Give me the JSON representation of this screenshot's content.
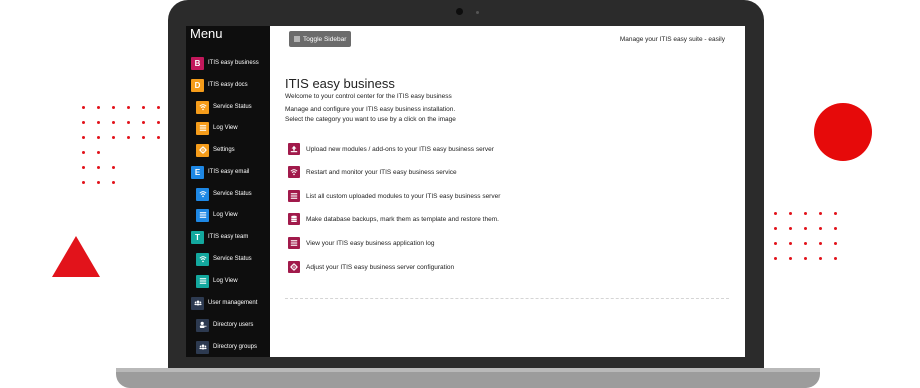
{
  "sidebar": {
    "title": "Menu",
    "items": [
      {
        "label": "ITIS easy business",
        "badge": "B",
        "color": "#c2185b",
        "level": 0
      },
      {
        "label": "ITIS easy docs",
        "badge": "D",
        "color": "#f59c1a",
        "level": 0
      },
      {
        "label": "Service Status",
        "icon": "wifi-icon",
        "color": "#f59c1a",
        "level": 1
      },
      {
        "label": "Log View",
        "icon": "list-icon",
        "color": "#f59c1a",
        "level": 1
      },
      {
        "label": "Settings",
        "icon": "gear-icon",
        "color": "#f59c1a",
        "level": 1
      },
      {
        "label": "ITIS easy email",
        "badge": "E",
        "color": "#1e88e5",
        "level": 0
      },
      {
        "label": "Service Status",
        "icon": "wifi-icon",
        "color": "#1e88e5",
        "level": 1
      },
      {
        "label": "Log View",
        "icon": "list-icon",
        "color": "#1e88e5",
        "level": 1
      },
      {
        "label": "ITIS easy team",
        "badge": "T",
        "color": "#13a89e",
        "level": 0
      },
      {
        "label": "Service Status",
        "icon": "wifi-icon",
        "color": "#13a89e",
        "level": 1
      },
      {
        "label": "Log View",
        "icon": "list-icon",
        "color": "#13a89e",
        "level": 1
      },
      {
        "label": "User management",
        "icon": "users-icon",
        "color": "#2d3a50",
        "level": 0
      },
      {
        "label": "Directory users",
        "icon": "user-icon",
        "color": "#2d3a50",
        "level": 1
      },
      {
        "label": "Directory groups",
        "icon": "users-icon",
        "color": "#2d3a50",
        "level": 1
      }
    ]
  },
  "header": {
    "toggle_label": "Toggle Sidebar",
    "tagline": "Manage your ITIS easy suite - easily"
  },
  "main": {
    "title": "ITIS easy business",
    "intro": [
      "Welcome to your control center for the ITIS easy business",
      "Manage and configure your ITIS easy business installation.",
      "Select the category you want to use by a click on the image"
    ],
    "actions": [
      {
        "label": "Upload new modules / add-ons to your ITIS easy business server",
        "icon": "upload-icon"
      },
      {
        "label": "Restart and monitor your ITIS easy business service",
        "icon": "wifi-icon"
      },
      {
        "label": "List all custom uploaded modules to your ITIS easy business server",
        "icon": "list-icon"
      },
      {
        "label": "Make database backups, mark them as template and restore them.",
        "icon": "database-icon"
      },
      {
        "label": "View your ITIS easy business application log",
        "icon": "list-icon"
      },
      {
        "label": "Adjust your ITIS easy business server configuration",
        "icon": "gear-icon"
      }
    ],
    "accent": "#a11a4b"
  },
  "decor": {
    "accent": "#e2131b"
  }
}
